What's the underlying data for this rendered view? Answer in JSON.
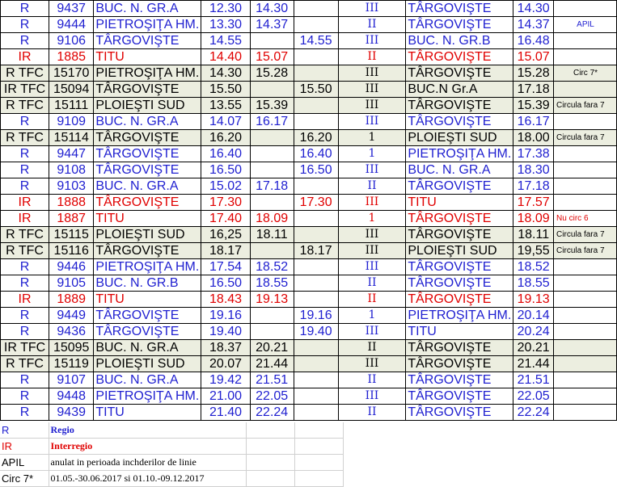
{
  "rows": [
    {
      "cat": "R",
      "num": "9437",
      "from": "BUC. N. GR.A",
      "dep": "12.30",
      "arr": "14.30",
      "t": "",
      "tr": "III",
      "dest": "TÂRGOVIŞTE",
      "ta": "14.30",
      "note": "",
      "cls": "blue",
      "shade": false
    },
    {
      "cat": "R",
      "num": "9444",
      "from": "PIETROŞIŢA HM.",
      "dep": "13.30",
      "arr": "14.37",
      "t": "",
      "tr": "II",
      "dest": "TÂRGOVIŞTE",
      "ta": "14.37",
      "note": "APIL",
      "cls": "blue",
      "shade": false
    },
    {
      "cat": "R",
      "num": "9106",
      "from": "TÂRGOVIŞTE",
      "dep": "14.55",
      "arr": "",
      "t": "14.55",
      "tr": "III",
      "dest": "BUC. N. GR.B",
      "ta": "16.48",
      "note": "",
      "cls": "blue",
      "shade": false
    },
    {
      "cat": "IR",
      "num": "1885",
      "from": "TITU",
      "dep": "14.40",
      "arr": "15.07",
      "t": "",
      "tr": "II",
      "dest": "TÂRGOVIŞTE",
      "ta": "15.07",
      "note": "",
      "cls": "red",
      "shade": false
    },
    {
      "cat": "R TFC",
      "num": "15170",
      "from": "PIETROŞIŢA HM.",
      "dep": "14.30",
      "arr": "15.28",
      "t": "",
      "tr": "III",
      "dest": "TÂRGOVIŞTE",
      "ta": "15.28",
      "note": "Circ 7*",
      "cls": "black",
      "shade": true
    },
    {
      "cat": "IR TFC",
      "num": "15094",
      "from": "TÂRGOVIŞTE",
      "dep": "15.50",
      "arr": "",
      "t": "15.50",
      "tr": "III",
      "dest": "BUC.N Gr.A",
      "ta": "17.18",
      "note": "",
      "cls": "black",
      "shade": true
    },
    {
      "cat": "R TFC",
      "num": "15111",
      "from": "PLOIEŞTI SUD",
      "dep": "13.55",
      "arr": "15.39",
      "t": "",
      "tr": "III",
      "dest": "TÂRGOVIŞTE",
      "ta": "15.39",
      "note": "Circula fara 7",
      "cls": "black",
      "shade": true
    },
    {
      "cat": "R",
      "num": "9109",
      "from": "BUC. N. GR.A",
      "dep": "14.07",
      "arr": "16.17",
      "t": "",
      "tr": "III",
      "dest": "TÂRGOVIŞTE",
      "ta": "16.17",
      "note": "",
      "cls": "blue",
      "shade": false
    },
    {
      "cat": "R TFC",
      "num": "15114",
      "from": "TÂRGOVIŞTE",
      "dep": "16.20",
      "arr": "",
      "t": "16.20",
      "tr": "1",
      "dest": "PLOIEŞTI SUD",
      "ta": "18.00",
      "note": "Circula fara 7",
      "cls": "black",
      "shade": true
    },
    {
      "cat": "R",
      "num": "9447",
      "from": "TÂRGOVIŞTE",
      "dep": "16.40",
      "arr": "",
      "t": "16.40",
      "tr": "1",
      "dest": "PIETROŞIŢA HM.",
      "ta": "17.38",
      "note": "",
      "cls": "blue",
      "shade": false
    },
    {
      "cat": "R",
      "num": "9108",
      "from": "TÂRGOVIŞTE",
      "dep": "16.50",
      "arr": "",
      "t": "16.50",
      "tr": "III",
      "dest": "BUC. N. GR.A",
      "ta": "18.30",
      "note": "",
      "cls": "blue",
      "shade": false
    },
    {
      "cat": "R",
      "num": "9103",
      "from": "BUC. N. GR.A",
      "dep": "15.02",
      "arr": "17.18",
      "t": "",
      "tr": "II",
      "dest": "TÂRGOVIŞTE",
      "ta": "17.18",
      "note": "",
      "cls": "blue",
      "shade": false
    },
    {
      "cat": "IR",
      "num": "1888",
      "from": "TÂRGOVIŞTE",
      "dep": "17.30",
      "arr": "",
      "t": "17.30",
      "tr": "III",
      "dest": "TITU",
      "ta": "17.57",
      "note": "",
      "cls": "red",
      "shade": false
    },
    {
      "cat": "IR",
      "num": "1887",
      "from": "TITU",
      "dep": "17.40",
      "arr": "18.09",
      "t": "",
      "tr": "1",
      "dest": "TÂRGOVIŞTE",
      "ta": "18.09",
      "note": "Nu circ 6",
      "cls": "red",
      "shade": false
    },
    {
      "cat": "R TFC",
      "num": "15115",
      "from": "PLOIEŞTI SUD",
      "dep": "16,25",
      "arr": "18.11",
      "t": "",
      "tr": "III",
      "dest": "TÂRGOVIŞTE",
      "ta": "18.11",
      "note": "Circula fara 7",
      "cls": "black",
      "shade": true
    },
    {
      "cat": "R TFC",
      "num": "15116",
      "from": "TÂRGOVIŞTE",
      "dep": "18.17",
      "arr": "",
      "t": "18.17",
      "tr": "III",
      "dest": "PLOIEŞTI SUD",
      "ta": "19,55",
      "note": "Circula fara 7",
      "cls": "black",
      "shade": true
    },
    {
      "cat": "R",
      "num": "9446",
      "from": "PIETROŞIŢA HM.",
      "dep": "17.54",
      "arr": "18.52",
      "t": "",
      "tr": "III",
      "dest": "TÂRGOVIŞTE",
      "ta": "18.52",
      "note": "",
      "cls": "blue",
      "shade": false
    },
    {
      "cat": "R",
      "num": "9105",
      "from": "BUC. N. GR.B",
      "dep": "16.50",
      "arr": "18.55",
      "t": "",
      "tr": "II",
      "dest": "TÂRGOVIŞTE",
      "ta": "18.55",
      "note": "",
      "cls": "blue",
      "shade": false
    },
    {
      "cat": "IR",
      "num": "1889",
      "from": "TITU",
      "dep": "18.43",
      "arr": "19.13",
      "t": "",
      "tr": "II",
      "dest": "TÂRGOVIŞTE",
      "ta": "19.13",
      "note": "",
      "cls": "red",
      "shade": false
    },
    {
      "cat": "R",
      "num": "9449",
      "from": "TÂRGOVIŞTE",
      "dep": "19.16",
      "arr": "",
      "t": "19.16",
      "tr": "1",
      "dest": "PIETROŞIŢA HM.",
      "ta": "20.14",
      "note": "",
      "cls": "blue",
      "shade": false
    },
    {
      "cat": "R",
      "num": "9436",
      "from": "TÂRGOVIŞTE",
      "dep": "19.40",
      "arr": "",
      "t": "19.40",
      "tr": "III",
      "dest": "TITU",
      "ta": "20.24",
      "note": "",
      "cls": "blue",
      "shade": false
    },
    {
      "cat": "IR TFC",
      "num": "15095",
      "from": "BUC. N. GR.A",
      "dep": "18.37",
      "arr": "20.21",
      "t": "",
      "tr": "II",
      "dest": "TÂRGOVIŞTE",
      "ta": "20.21",
      "note": "",
      "cls": "black",
      "shade": true
    },
    {
      "cat": "R TFC",
      "num": "15119",
      "from": "PLOIEŞTI SUD",
      "dep": "20.07",
      "arr": "21.44",
      "t": "",
      "tr": "III",
      "dest": "TÂRGOVIŞTE",
      "ta": "21.44",
      "note": "",
      "cls": "black",
      "shade": true
    },
    {
      "cat": "R",
      "num": "9107",
      "from": "BUC. N. GR.A",
      "dep": "19.42",
      "arr": "21.51",
      "t": "",
      "tr": "II",
      "dest": "TÂRGOVIŞTE",
      "ta": "21.51",
      "note": "",
      "cls": "blue",
      "shade": false
    },
    {
      "cat": "R",
      "num": "9448",
      "from": "PIETROŞIŢA HM.",
      "dep": "21.00",
      "arr": "22.05",
      "t": "",
      "tr": "III",
      "dest": "TÂRGOVIŞTE",
      "ta": "22.05",
      "note": "",
      "cls": "blue",
      "shade": false
    },
    {
      "cat": "R",
      "num": "9439",
      "from": "TITU",
      "dep": "21.40",
      "arr": "22.24",
      "t": "",
      "tr": "II",
      "dest": "TÂRGOVIŞTE",
      "ta": "22.24",
      "note": "",
      "cls": "blue",
      "shade": false
    }
  ],
  "legend": [
    {
      "key": "R",
      "value": "Regio",
      "cls": "blue"
    },
    {
      "key": "IR",
      "value": "Interregio",
      "cls": "red"
    },
    {
      "key": "APIL",
      "value": "anulat in perioada inchderilor de linie",
      "cls": "black"
    },
    {
      "key": "Circ 7*",
      "value": "01.05.-30.06.2017 si 01.10.-09.12.2017",
      "cls": "black"
    }
  ],
  "colors": {
    "regio": "#1f1fd0",
    "interregio": "#e00000",
    "tfc": "#000000",
    "shade": "#eceee0"
  }
}
